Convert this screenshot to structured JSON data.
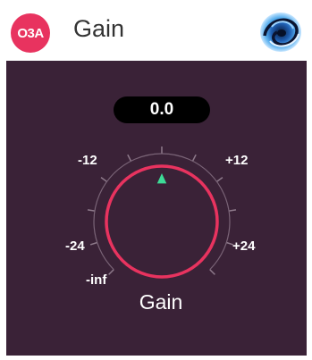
{
  "header": {
    "badge_text": "O3A",
    "badge_color": "#e8335f",
    "title": "Gain",
    "logo_icon": "spiral-logo-icon"
  },
  "knob": {
    "value_display": "0.0",
    "label": "Gain",
    "value_db": 0.0,
    "scale_labels": {
      "m12": "-12",
      "p12": "+12",
      "m24": "-24",
      "p24": "+24",
      "minf": "-inf"
    },
    "ring_color": "#e8335f",
    "indicator_color": "#3ddc97",
    "panel_color": "#3a2237"
  }
}
